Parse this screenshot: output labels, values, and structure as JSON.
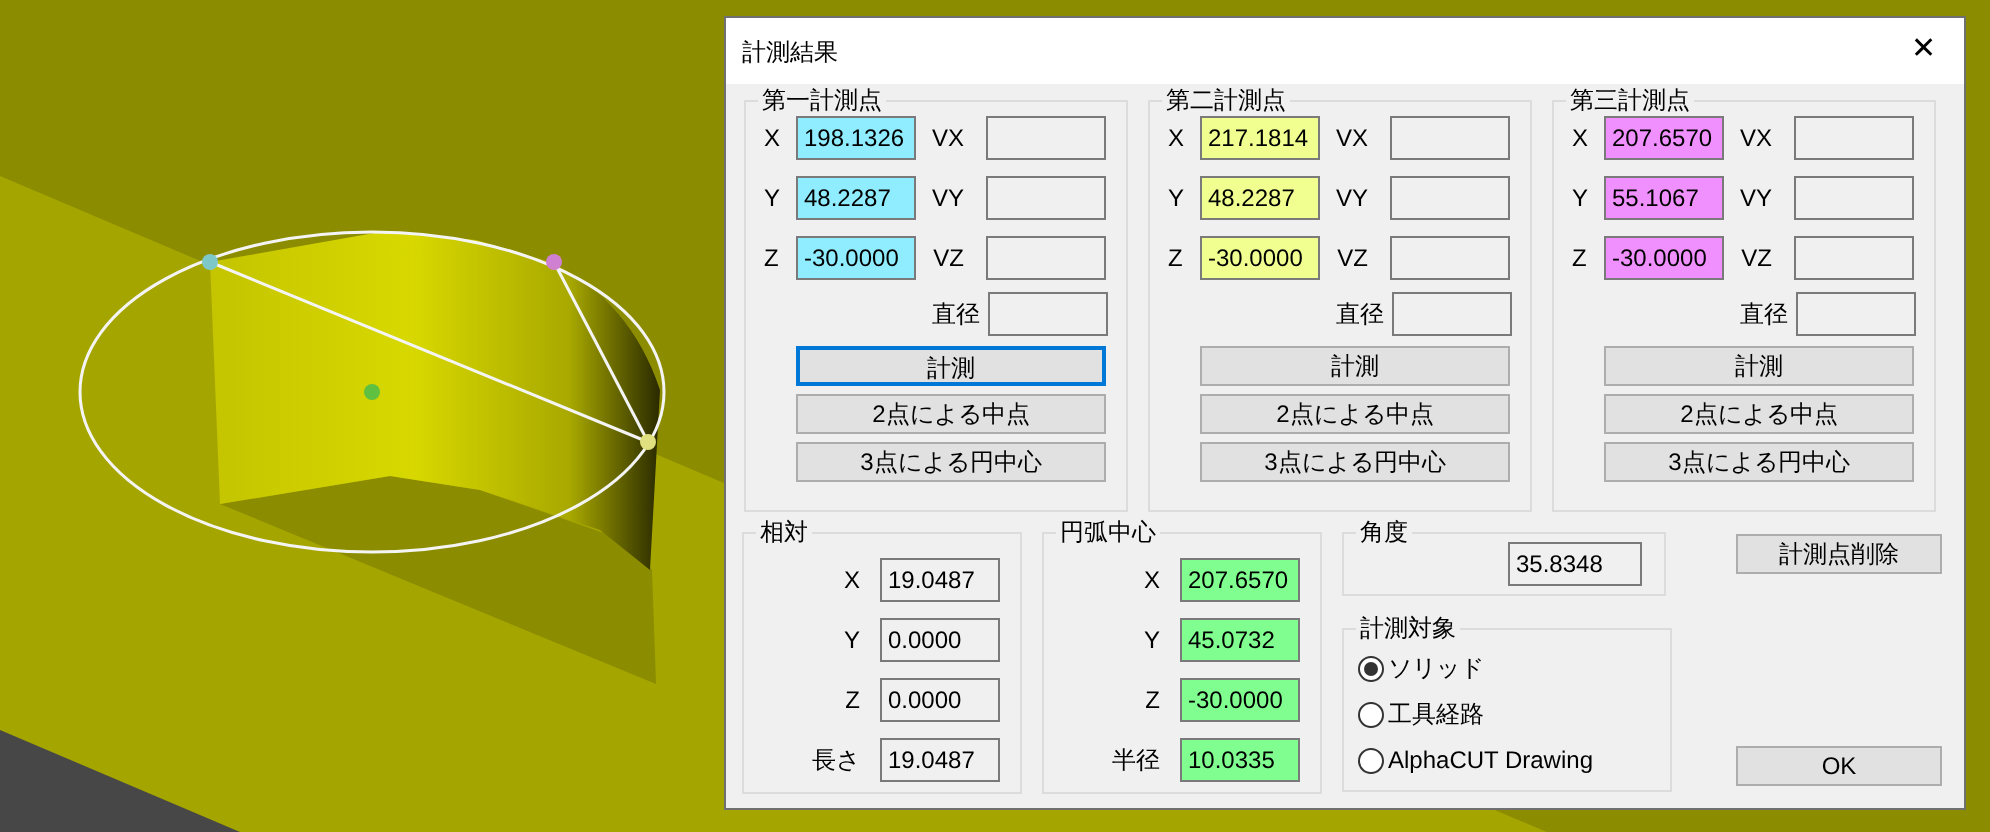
{
  "window": {
    "title": "計測結果",
    "close": "✕"
  },
  "points": [
    {
      "title": "第一計測点",
      "color": "#90ecff",
      "fields": [
        {
          "label": "X",
          "value": "198.1326",
          "v_label": "VX"
        },
        {
          "label": "Y",
          "value": "48.2287",
          "v_label": "VY"
        },
        {
          "label": "Z",
          "value": "-30.0000",
          "v_label": "VZ"
        }
      ],
      "diameter_label": "直径",
      "buttons": [
        {
          "label": "計測",
          "focused": true
        },
        {
          "label": "2点による中点",
          "focused": false
        },
        {
          "label": "3点による円中心",
          "focused": false
        }
      ]
    },
    {
      "title": "第二計測点",
      "color": "#f0ff90",
      "fields": [
        {
          "label": "X",
          "value": "217.1814",
          "v_label": "VX"
        },
        {
          "label": "Y",
          "value": "48.2287",
          "v_label": "VY"
        },
        {
          "label": "Z",
          "value": "-30.0000",
          "v_label": "VZ"
        }
      ],
      "diameter_label": "直径",
      "buttons": [
        {
          "label": "計測",
          "focused": false
        },
        {
          "label": "2点による中点",
          "focused": false
        },
        {
          "label": "3点による円中心",
          "focused": false
        }
      ]
    },
    {
      "title": "第三計測点",
      "color": "#f090ff",
      "fields": [
        {
          "label": "X",
          "value": "207.6570",
          "v_label": "VX"
        },
        {
          "label": "Y",
          "value": "55.1067",
          "v_label": "VY"
        },
        {
          "label": "Z",
          "value": "-30.0000",
          "v_label": "VZ"
        }
      ],
      "diameter_label": "直径",
      "buttons": [
        {
          "label": "計測",
          "focused": false
        },
        {
          "label": "2点による中点",
          "focused": false
        },
        {
          "label": "3点による円中心",
          "focused": false
        }
      ]
    }
  ],
  "relative": {
    "title": "相対",
    "color": "#f0f0f0",
    "rows": [
      {
        "label": "X",
        "value": "19.0487"
      },
      {
        "label": "Y",
        "value": "0.0000"
      },
      {
        "label": "Z",
        "value": "0.0000"
      },
      {
        "label": "長さ",
        "value": "19.0487"
      }
    ]
  },
  "arc_center": {
    "title": "円弧中心",
    "color": "#80ff90",
    "rows": [
      {
        "label": "X",
        "value": "207.6570"
      },
      {
        "label": "Y",
        "value": "45.0732"
      },
      {
        "label": "Z",
        "value": "-30.0000"
      },
      {
        "label": "半径",
        "value": "10.0335"
      }
    ]
  },
  "angle": {
    "title": "角度",
    "value": "35.8348"
  },
  "target": {
    "title": "計測対象",
    "options": [
      {
        "label": "ソリッド",
        "selected": true
      },
      {
        "label": "工具経路",
        "selected": false
      },
      {
        "label": "AlphaCUT Drawing",
        "selected": false
      }
    ]
  },
  "buttons": {
    "delete": "計測点削除",
    "ok": "OK"
  }
}
